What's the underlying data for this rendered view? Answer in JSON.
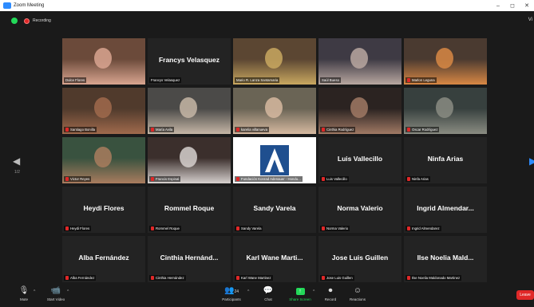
{
  "window": {
    "title": "Zoom Meeting",
    "controls": [
      "–",
      "◻",
      "✕"
    ]
  },
  "status": {
    "recording_label": "Recording",
    "view_label": "Vi"
  },
  "pagination": {
    "left_page": "1/2",
    "right_page": ""
  },
  "participants": [
    {
      "name": "Dulce Flores",
      "big": "",
      "video": true,
      "muted": false,
      "colors": [
        "#6b4a3a",
        "#d9a590"
      ]
    },
    {
      "name": "Francys Velasquez",
      "big": "Francys Velasquez",
      "video": false,
      "muted": false
    },
    {
      "name": "Mario R. Lanza Santamaria",
      "big": "",
      "video": true,
      "muted": false,
      "speaking": true,
      "colors": [
        "#5b4632",
        "#c9a860"
      ]
    },
    {
      "name": "Saúl Bueso",
      "big": "",
      "video": true,
      "muted": false,
      "colors": [
        "#3e3a44",
        "#b8a7a0"
      ]
    },
    {
      "name": "Marlon Leguna",
      "big": "",
      "video": true,
      "muted": true,
      "colors": [
        "#4a3a30",
        "#d88844"
      ]
    },
    {
      "name": "Santiago Bonilla",
      "big": "",
      "video": true,
      "muted": true,
      "colors": [
        "#503a2c",
        "#a06a4c"
      ]
    },
    {
      "name": "María Avila",
      "big": "",
      "video": true,
      "muted": true,
      "colors": [
        "#4b4a48",
        "#c5b6a6"
      ]
    },
    {
      "name": "karelia villanueva",
      "big": "",
      "video": true,
      "muted": true,
      "colors": [
        "#6a6455",
        "#d6b9a0"
      ]
    },
    {
      "name": "Cinthia Rodríguez",
      "big": "",
      "video": true,
      "muted": true,
      "colors": [
        "#2b2321",
        "#a07964"
      ]
    },
    {
      "name": "Oscar Rodríguez",
      "big": "",
      "video": true,
      "muted": true,
      "colors": [
        "#37403e",
        "#8a8c82"
      ]
    },
    {
      "name": "Victor Reyes",
      "big": "",
      "video": true,
      "muted": true,
      "colors": [
        "#39523f",
        "#a97c5e"
      ]
    },
    {
      "name": "Francis Espinal",
      "big": "",
      "video": true,
      "muted": true,
      "colors": [
        "#3b2f2c",
        "#d6d0ce"
      ]
    },
    {
      "name": "Fundación Konrad Adenauer - Hondu...",
      "big": "",
      "video": true,
      "muted": true,
      "logo": true
    },
    {
      "name": "Luis Vallecillo",
      "big": "Luis Vallecillo",
      "video": false,
      "muted": true
    },
    {
      "name": "Ninfa Arias",
      "big": "Ninfa Arias",
      "video": false,
      "muted": true
    },
    {
      "name": "Heydi Flores",
      "big": "Heydi Flores",
      "video": false,
      "muted": true
    },
    {
      "name": "Rommel Roque",
      "big": "Rommel Roque",
      "video": false,
      "muted": true
    },
    {
      "name": "Sandy Varela",
      "big": "Sandy Varela",
      "video": false,
      "muted": true
    },
    {
      "name": "Norma Valerio",
      "big": "Norma Valerio",
      "video": false,
      "muted": true
    },
    {
      "name": "Ingrid Almendarez",
      "big": "Ingrid Almendar...",
      "video": false,
      "muted": true
    },
    {
      "name": "Alba Fernández",
      "big": "Alba Fernández",
      "video": false,
      "muted": true
    },
    {
      "name": "Cinthia Hernández",
      "big": "Cinthia Hernánd...",
      "video": false,
      "muted": true
    },
    {
      "name": "Karl Wane Martinez",
      "big": "Karl Wane Marti...",
      "video": false,
      "muted": true
    },
    {
      "name": "Jose Luis Guillen",
      "big": "Jose Luis Guillen",
      "video": false,
      "muted": true
    },
    {
      "name": "Ilse Noelia Maldonado Martinez",
      "big": "Ilse Noelia Mald...",
      "video": false,
      "muted": true
    }
  ],
  "toolbar": {
    "mute": "Mute",
    "start_video": "Start Video",
    "participants": "Participants",
    "participants_count": "24",
    "chat": "Chat",
    "share_screen": "Share Screen",
    "record": "Record",
    "reactions": "Reactions",
    "leave": "Leave"
  },
  "colors": {
    "accent_green": "#23d959",
    "danger_red": "#e02828",
    "speaking_yellow": "#d8d817"
  }
}
